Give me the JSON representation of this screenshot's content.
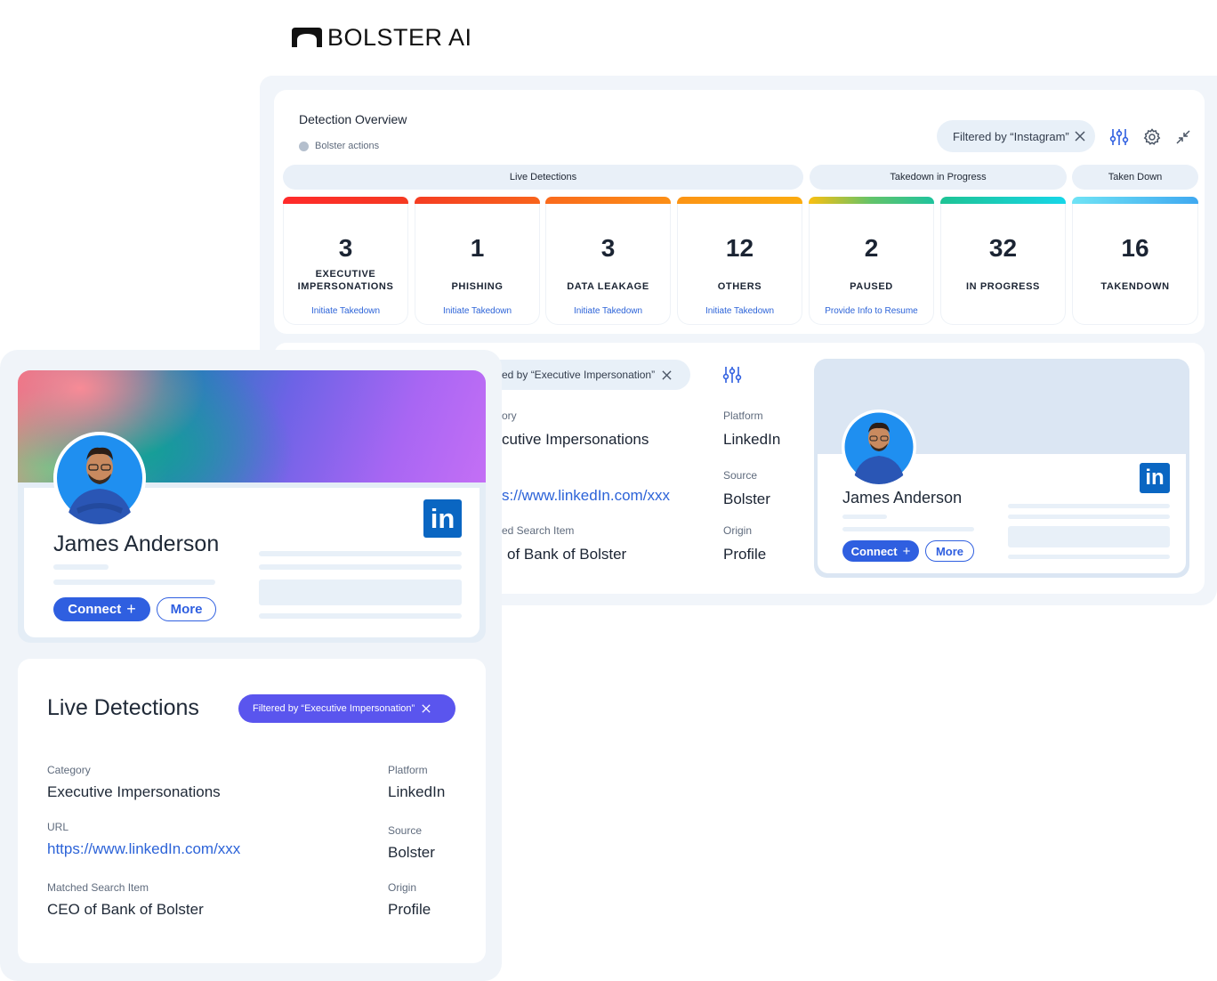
{
  "brand": {
    "name": "BOLSTER AI"
  },
  "overview": {
    "title": "Detection Overview",
    "legend": "Bolster actions",
    "filter": "Filtered by “Instagram”",
    "groups": [
      {
        "label": "Live Detections"
      },
      {
        "label": "Takedown in Progress"
      },
      {
        "label": "Taken Down"
      }
    ],
    "stats": [
      {
        "value": "3",
        "label": "EXECUTIVE IMPERSONATIONS",
        "action": "Initiate Takedown",
        "color": "#f5302a"
      },
      {
        "value": "1",
        "label": "PHISHING",
        "action": "Initiate Takedown",
        "color": "#f6501f"
      },
      {
        "value": "3",
        "label": "DATA LEAKAGE",
        "action": "Initiate Takedown",
        "color": "#fb7a1a"
      },
      {
        "value": "12",
        "label": "OTHERS",
        "action": "Initiate Takedown",
        "color": "#fca012"
      },
      {
        "value": "2",
        "label": "PAUSED",
        "action": "Provide Info to Resume",
        "color": "#f6c21a"
      },
      {
        "value": "32",
        "label": "IN PROGRESS",
        "action": "",
        "color": "#1ec8a9"
      },
      {
        "value": "16",
        "label": "TAKENDOWN",
        "action": "",
        "color": "#5ad2f5"
      }
    ]
  },
  "back_detail": {
    "filter_partial": "ed by “Executive Impersonation”",
    "category_label_partial": "ory",
    "category_value_partial": "cutive Impersonations",
    "url_partial": "s://www.linkedIn.com/xxx",
    "matched_label_partial": "ed Search Item",
    "matched_value_partial": "of Bank of Bolster",
    "platform_label": "Platform",
    "platform_value": "LinkedIn",
    "source_label": "Source",
    "source_value": "Bolster",
    "origin_label": "Origin",
    "origin_value": "Profile",
    "profile": {
      "name": "James Anderson",
      "connect": "Connect",
      "more": "More",
      "li": "in"
    }
  },
  "front_profile": {
    "name": "James Anderson",
    "connect": "Connect",
    "more": "More",
    "li": "in"
  },
  "live_detections": {
    "title": "Live Detections",
    "filter": "Filtered by “Executive Impersonation”",
    "category_label": "Category",
    "category_value": "Executive Impersonations",
    "url_label": "URL",
    "url_value": "https://www.linkedIn.com/xxx",
    "matched_label": "Matched Search Item",
    "matched_value": "CEO of Bank of Bolster",
    "platform_label": "Platform",
    "platform_value": "LinkedIn",
    "source_label": "Source",
    "source_value": "Bolster",
    "origin_label": "Origin",
    "origin_value": "Profile"
  }
}
